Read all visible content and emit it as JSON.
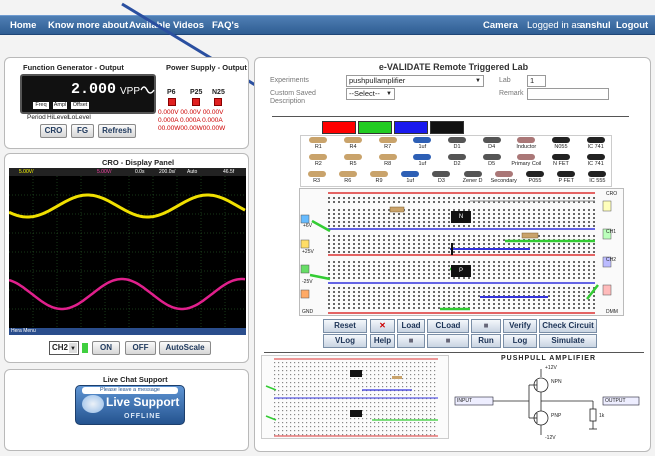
{
  "nav": {
    "home": "Home",
    "know_more": "Know more about",
    "videos": "Available Videos",
    "faq": "FAQ's",
    "camera": "Camera",
    "logged_in": "Logged in as",
    "user": "anshul",
    "logout": "Logout"
  },
  "function_generator": {
    "title": "Function Generator - Output",
    "amplitude": "2.000",
    "unit": "VPP",
    "freq_label": "Freq",
    "amp_label": "Ampl",
    "offset_label": "Offset",
    "period_label": "Period",
    "hilevel_label": "HiLevel",
    "lolevel_label": "LoLevel",
    "buttons": [
      "CRO",
      "FG",
      "Refresh"
    ]
  },
  "power_supply": {
    "title": "Power Supply - Output",
    "channels": [
      "P6",
      "P25",
      "N25"
    ],
    "volt_line": "0.000V 00.00V 00.00V",
    "amp_line": "0.000A 0.000A 0.000A",
    "watt_line": "00.00W00.00W00.00W"
  },
  "cro": {
    "title": "CRO - Display Panel",
    "status_left": "5.00V/",
    "status_mid": "5.00V/",
    "status_time": "0.0s",
    "status_rate": "200.0s/",
    "status_mode": "Auto",
    "status_right": "46.5f",
    "menu_label": "Hera Menu",
    "channel_select": "CH2",
    "buttons": [
      "ON",
      "OFF",
      "AutoScale"
    ]
  },
  "chat": {
    "title": "Live Chat Support",
    "leave_message": "Please leave a message",
    "live_support": "Live Support",
    "offline": "OFFLINE"
  },
  "lab": {
    "title": "e-VALIDATE Remote Triggered Lab",
    "experiments_label": "Experiments",
    "experiment_value": "pushpullamplifier",
    "lab_label": "Lab",
    "lab_value": "1",
    "saved_label": "Custom Saved Description",
    "saved_value": "--Select--",
    "remark_label": "Remark",
    "remark_value": "",
    "color_swatches": [
      "#ff0000",
      "#22cc22",
      "#1a1aee",
      "#111111"
    ]
  },
  "components": {
    "row1": [
      "R1",
      "R4",
      "R7",
      "1uf",
      "D1",
      "D4",
      "Inductor",
      "N055",
      "IC 741"
    ],
    "row2": [
      "R2",
      "R5",
      "R8",
      "1uf",
      "D2",
      "D5",
      "Primary Coil",
      "N FET",
      "IC 741"
    ],
    "row3": [
      "R3",
      "R6",
      "R9",
      "1uf",
      "D3",
      "Zener D",
      "Secondary",
      "P055",
      "P FET",
      "IC 555"
    ]
  },
  "breadboard_labels": {
    "cro": "CRO",
    "ch1": "CH1",
    "ch2": "CH2",
    "dmm": "DMM",
    "p6": "+6V",
    "p25": "+25V",
    "n25": "-25V",
    "gnd": "GND",
    "n_chip": "N",
    "p_chip": "P"
  },
  "toolbar": {
    "row1": [
      "Reset",
      "",
      "Load",
      "CLoad",
      "",
      "Verify",
      "Check Circuit"
    ],
    "row2": [
      "VLog",
      "Help",
      "",
      "",
      "Run",
      "Log",
      "Simulate"
    ]
  },
  "schematic": {
    "title": "PUSHPULL AMPLIFIER",
    "vcc": "+12V",
    "vee": "-12V",
    "q1": "NPN",
    "q2": "PNP",
    "input": "INPUT",
    "output": "OUTPUT",
    "load": "1k"
  }
}
